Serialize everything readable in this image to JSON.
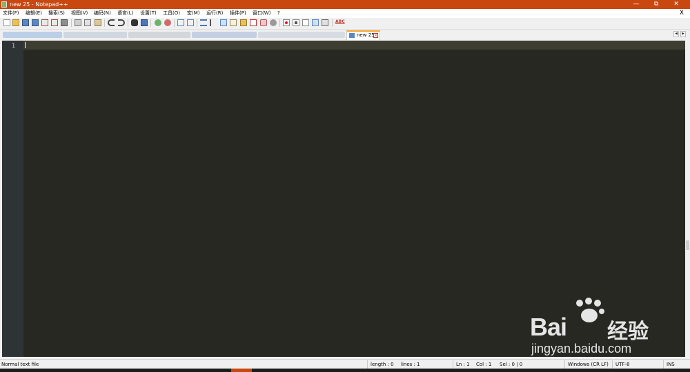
{
  "window": {
    "title": "new 25 - Notepad++",
    "controls": {
      "minimize": "—",
      "maximize": "⧉",
      "close": "✕"
    }
  },
  "menu": {
    "items": [
      "文件(F)",
      "编辑(E)",
      "搜索(S)",
      "视图(V)",
      "编码(N)",
      "语言(L)",
      "设置(T)",
      "工具(O)",
      "宏(M)",
      "运行(R)",
      "插件(P)",
      "窗口(W)",
      "?"
    ],
    "close_document": "X"
  },
  "toolbar": {
    "buttons": [
      "new-file",
      "open-file",
      "save",
      "save-all",
      "close",
      "close-all",
      "print",
      "cut",
      "copy",
      "paste",
      "undo",
      "redo",
      "find",
      "replace",
      "zoom-in",
      "zoom-out",
      "sync-vertical",
      "sync-horizontal",
      "word-wrap",
      "show-all-characters",
      "indent-guide",
      "define-language",
      "document-map",
      "function-list",
      "folder-as-workspace",
      "monitoring",
      "record-macro",
      "stop-recording",
      "play-macro",
      "run-macro-multiple",
      "save-macro",
      "spell-check"
    ],
    "spell_check_label": "ABC"
  },
  "tabs": {
    "active": {
      "label": "new 25"
    }
  },
  "editor": {
    "line_numbers": [
      "1"
    ],
    "content": ""
  },
  "status": {
    "file_type": "Normal text file",
    "length": "length : 0",
    "lines": "lines : 1",
    "ln": "Ln : 1",
    "col": "Col : 1",
    "sel": "Sel : 0 | 0",
    "eol": "Windows (CR LF)",
    "encoding": "UTF-8",
    "mode": "INS"
  },
  "watermark": {
    "brand_latin": "Bai",
    "brand_cjk": "经验",
    "url": "jingyan.baidu.com"
  },
  "colors": {
    "titlebar": "#c9480f",
    "editor_background": "#272822",
    "gutter_background": "#2e3436",
    "current_line": "#3e3d32",
    "tab_accent": "#f3a530"
  }
}
